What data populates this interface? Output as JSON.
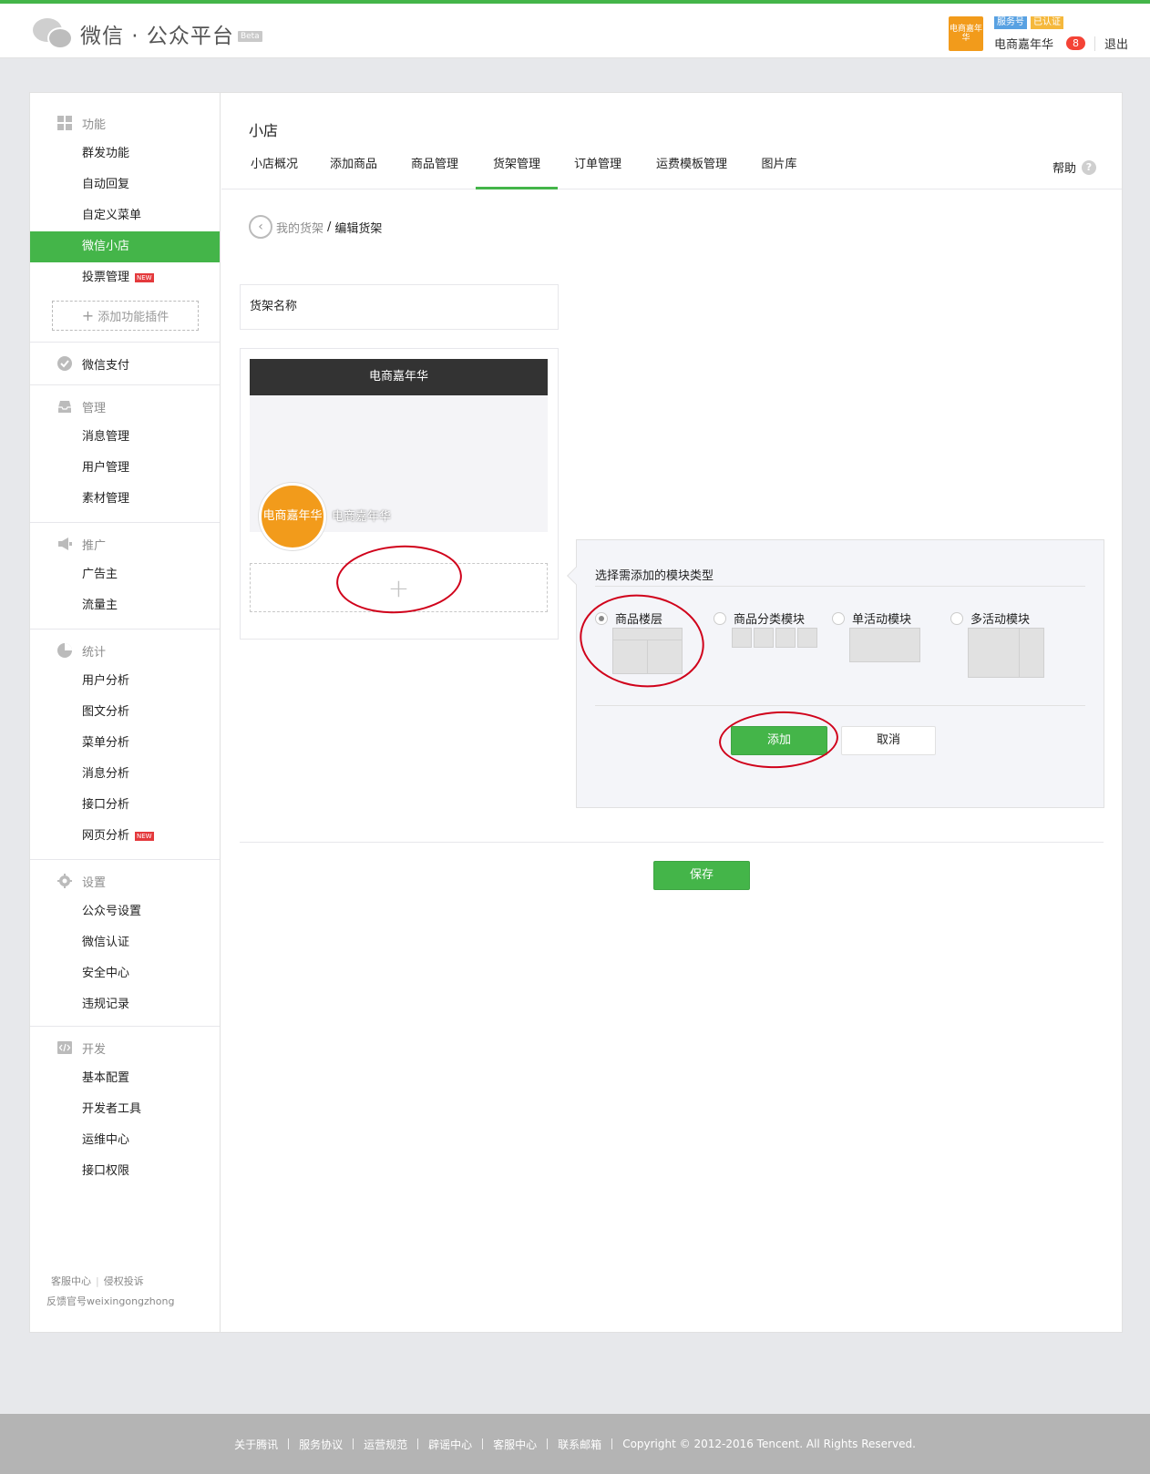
{
  "header": {
    "logo_text": "微信 · 公众平台",
    "beta": "Beta",
    "avatar_text": "电商嘉年华",
    "tag_service": "服务号",
    "tag_verified": "已认证",
    "account_name": "电商嘉年华",
    "notifications": "8",
    "logout": "退出"
  },
  "sidebar": {
    "groups": [
      {
        "title": "功能",
        "icon": "grid-icon",
        "items": [
          "群发功能",
          "自动回复",
          "自定义菜单",
          "微信小店",
          "投票管理"
        ]
      },
      {
        "title": "微信支付",
        "icon": "pay-icon",
        "items": []
      },
      {
        "title": "管理",
        "icon": "inbox-icon",
        "items": [
          "消息管理",
          "用户管理",
          "素材管理"
        ]
      },
      {
        "title": "推广",
        "icon": "megaphone-icon",
        "items": [
          "广告主",
          "流量主"
        ]
      },
      {
        "title": "统计",
        "icon": "pie-chart-icon",
        "items": [
          "用户分析",
          "图文分析",
          "菜单分析",
          "消息分析",
          "接口分析",
          "网页分析"
        ]
      },
      {
        "title": "设置",
        "icon": "gear-icon",
        "items": [
          "公众号设置",
          "微信认证",
          "安全中心",
          "违规记录"
        ]
      },
      {
        "title": "开发",
        "icon": "code-icon",
        "items": [
          "基本配置",
          "开发者工具",
          "运维中心",
          "接口权限"
        ]
      }
    ],
    "new_tag": "NEW",
    "add_plugin": "添加功能插件",
    "footer_service": "客服中心",
    "footer_complaint": "侵权投诉",
    "footer_feedback": "反馈官号weixingongzhong"
  },
  "content": {
    "page_title": "小店",
    "tabs": [
      "小店概况",
      "添加商品",
      "商品管理",
      "货架管理",
      "订单管理",
      "运费模板管理",
      "图片库"
    ],
    "active_tab": "货架管理",
    "help": "帮助",
    "breadcrumb_parent": "我的货架",
    "breadcrumb_current": "编辑货架",
    "shelf_name_label": "货架名称",
    "shelf_header": "电商嘉年华",
    "shelf_logo_text": "电商嘉年华",
    "shelf_logo_name": "电商嘉年华",
    "popover": {
      "title": "选择需添加的模块类型",
      "options": [
        "商品楼层",
        "商品分类模块",
        "单活动模块",
        "多活动模块"
      ],
      "selected": "商品楼层",
      "add": "添加",
      "cancel": "取消"
    },
    "save": "保存"
  },
  "footer": {
    "links": [
      "关于腾讯",
      "服务协议",
      "运营规范",
      "辟谣中心",
      "客服中心",
      "联系邮箱"
    ],
    "copyright": "Copyright © 2012-2016 Tencent. All Rights Reserved."
  },
  "colors": {
    "accent": "#44b549",
    "annotation": "#d0021b"
  }
}
